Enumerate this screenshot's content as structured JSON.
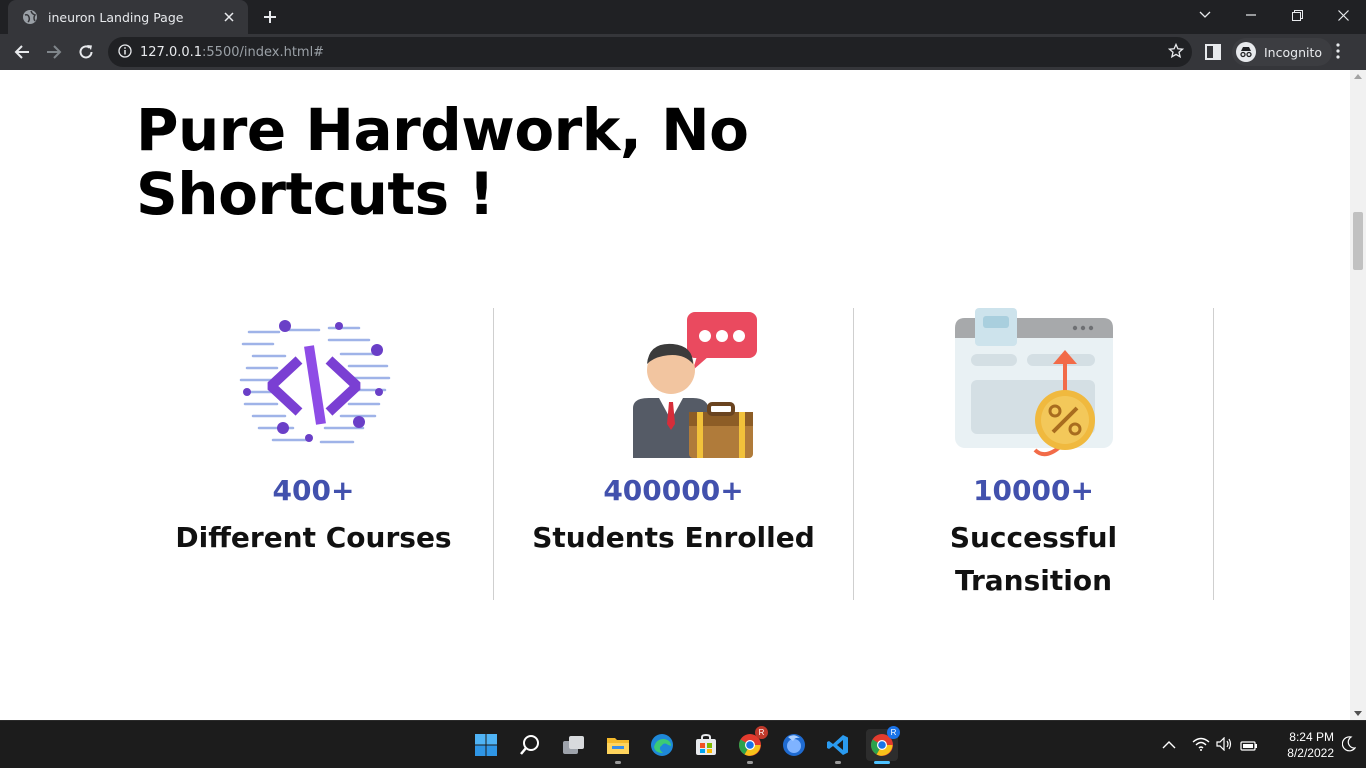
{
  "browser": {
    "tab_title": "ineuron Landing Page",
    "url_host": "127.0.0.1",
    "url_rest": ":5500/index.html#",
    "incognito_label": "Incognito"
  },
  "page": {
    "title": "Pure Hardwork, No Shortcuts !",
    "stats": [
      {
        "number": "400+",
        "label": "Different Courses",
        "icon": "code-icon"
      },
      {
        "number": "400000+",
        "label": "Students Enrolled",
        "icon": "student-icon"
      },
      {
        "number": "10000+",
        "label": "Successful Transition",
        "icon": "growth-icon"
      }
    ]
  },
  "taskbar": {
    "time": "8:24 PM",
    "date": "8/2/2022",
    "apps": [
      "start",
      "search",
      "task-view",
      "file-explorer",
      "edge",
      "microsoft-store",
      "chrome",
      "firefox",
      "vs-code",
      "chrome-incognito"
    ],
    "badges": {
      "chrome": "R",
      "chrome_incognito": "R"
    }
  },
  "colors": {
    "accent": "#4251ad",
    "chrome_dark": "#202124",
    "chrome_toolbar": "#35363a"
  }
}
